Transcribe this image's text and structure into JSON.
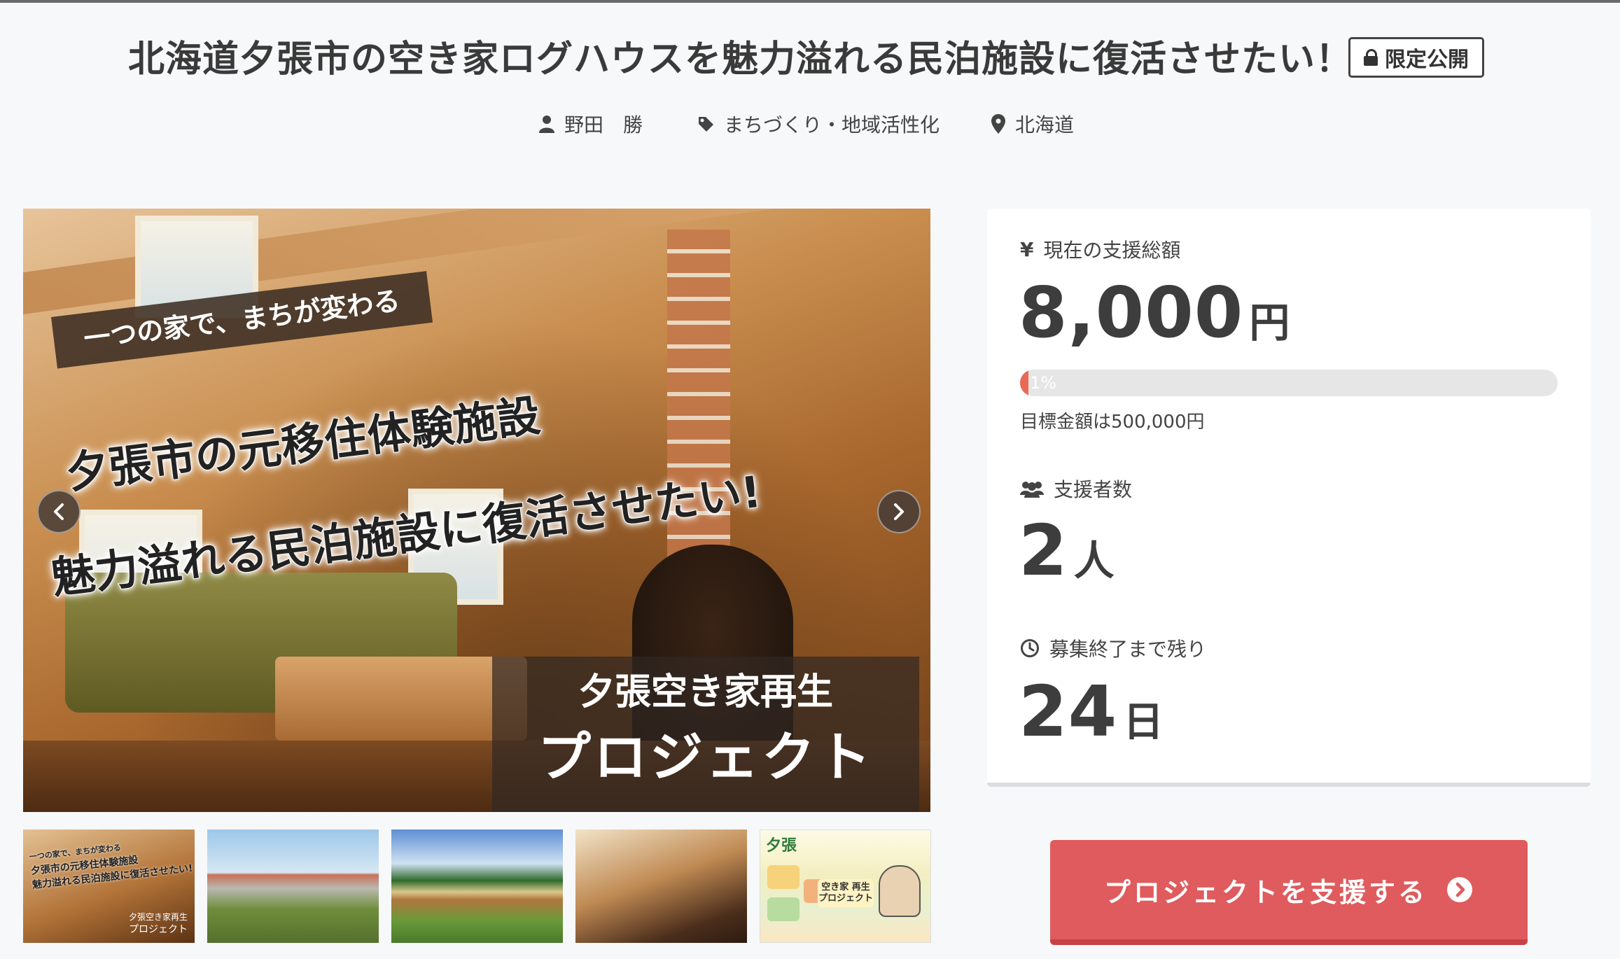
{
  "project": {
    "title": "北海道夕張市の空き家ログハウスを魅力溢れる民泊施設に復活させたい！",
    "badge": "限定公開",
    "author": "野田　勝",
    "category": "まちづくり・地域活性化",
    "location": "北海道"
  },
  "hero": {
    "tagline": "一つの家で、まちが変わる",
    "headline_1": "夕張市の元移住体験施設",
    "headline_2": "魅力溢れる民泊施設に復活させたい!",
    "caption_1": "夕張空き家再生",
    "caption_2": "プロジェクト",
    "thumbnails": [
      {
        "label_1": "一つの家で、まちが変わる",
        "label_2": "夕張市の元移住体験施設",
        "label_3": "魅力溢れる民泊施設に復活させたい!",
        "caption_1": "夕張空き家再生",
        "caption_2": "プロジェクト"
      },
      {},
      {},
      {},
      {
        "title": "夕張",
        "sub": "空き家 再生 プロジェクト"
      }
    ]
  },
  "stats": {
    "amount_label": "現在の支援総額",
    "amount": "8,000",
    "amount_unit": "円",
    "progress_percent_text": "1%",
    "progress_fraction": 0.016,
    "goal_text": "目標金額は500,000円",
    "backers_label": "支援者数",
    "backers": "2",
    "backers_unit": "人",
    "remaining_label": "募集終了まで残り",
    "remaining": "24",
    "remaining_unit": "日"
  },
  "cta": {
    "label": "プロジェクトを支援する"
  },
  "icons": {
    "badge": "lock-icon",
    "author": "user-icon",
    "category": "tag-icon",
    "location": "map-pin-icon",
    "amount": "yen-icon",
    "backers": "users-icon",
    "remaining": "clock-icon",
    "cta": "chevron-right-circle-icon",
    "prev": "chevron-left-icon",
    "next": "chevron-right-icon"
  },
  "colors": {
    "accent": "#df5b5d",
    "progress": "#e86a56",
    "background": "#f7f8f9"
  }
}
